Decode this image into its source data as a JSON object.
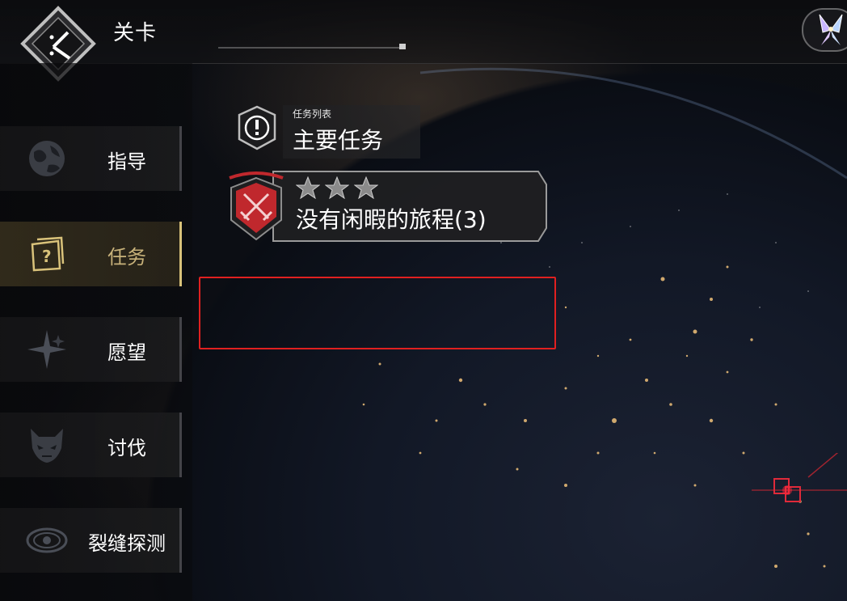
{
  "header": {
    "title": "关卡"
  },
  "sidebar": {
    "items": [
      {
        "label": "指导",
        "icon": "globe-icon",
        "active": false
      },
      {
        "label": "任务",
        "icon": "quest-card-icon",
        "active": true
      },
      {
        "label": "愿望",
        "icon": "sparkle-star-icon",
        "active": false
      },
      {
        "label": "讨伐",
        "icon": "demon-mask-icon",
        "active": false
      },
      {
        "label": "裂缝探测",
        "icon": "eye-scan-icon",
        "active": false
      }
    ]
  },
  "missions": {
    "list_small_label": "任务列表",
    "list_title": "主要任务",
    "cards": [
      {
        "name": "没有闲暇的旅程(3)",
        "stars_total": 3,
        "stars_earned": 0,
        "emblem": "crossed-swords-icon"
      }
    ]
  },
  "colors": {
    "accent_gold": "#d9c27a",
    "alert_red": "#e02020",
    "emblem_red": "#c0282d"
  }
}
